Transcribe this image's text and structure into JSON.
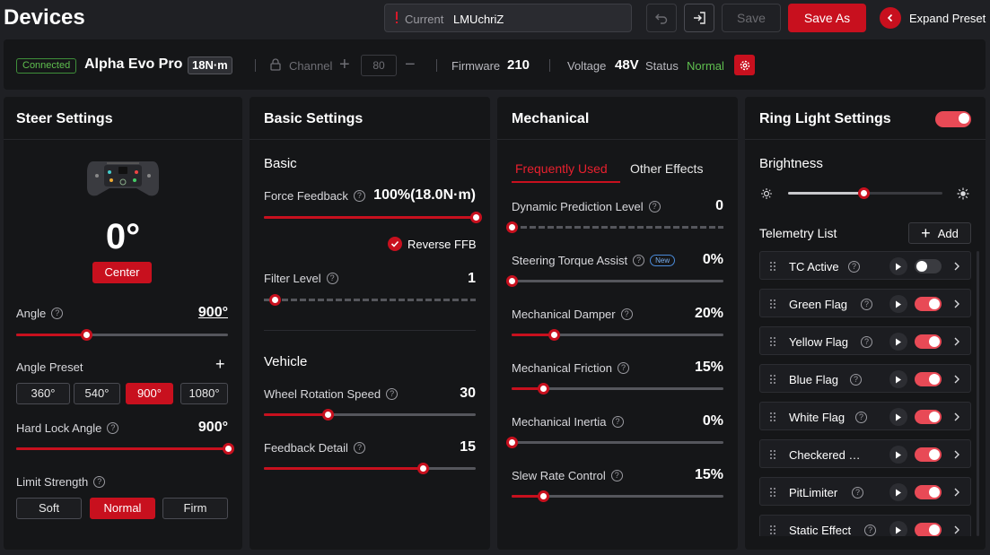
{
  "header": {
    "title": "Devices",
    "preset_label": "Current",
    "preset_value": "LMUchriZ",
    "save_label": "Save",
    "save_as_label": "Save As",
    "expand_label": "Expand Preset"
  },
  "device": {
    "status_badge": "Connected",
    "name": "Alpha Evo Pro",
    "torque": "18N·m",
    "channel_label": "Channel",
    "channel_value": "80",
    "firmware_label": "Firmware",
    "firmware_value": "210",
    "voltage_label": "Voltage",
    "voltage_value": "48V",
    "status_label": "Status",
    "status_value": "Normal"
  },
  "steer": {
    "title": "Steer Settings",
    "angle_display": "0°",
    "center_label": "Center",
    "angle_label": "Angle",
    "angle_value": "900°",
    "angle_level": 0.33,
    "preset_label": "Angle Preset",
    "presets": [
      "360°",
      "540°",
      "900°",
      "1080°"
    ],
    "active_preset": 2,
    "hard_lock_label": "Hard Lock Angle",
    "hard_lock_value": "900°",
    "hard_lock_level": 1.0,
    "limit_label": "Limit Strength",
    "limits": [
      "Soft",
      "Normal",
      "Firm"
    ],
    "active_limit": 1
  },
  "basic": {
    "title": "Basic Settings",
    "section_basic": "Basic",
    "ffb_label": "Force Feedback",
    "ffb_value": "100%(18.0N·m)",
    "ffb_level": 1.0,
    "reverse_label": "Reverse FFB",
    "filter_label": "Filter Level",
    "filter_value": "1",
    "filter_level": 0.05,
    "section_vehicle": "Vehicle",
    "wheel_speed_label": "Wheel Rotation Speed",
    "wheel_speed_value": "30",
    "wheel_speed_level": 0.3,
    "detail_label": "Feedback Detail",
    "detail_value": "15",
    "detail_level": 0.75
  },
  "mechanical": {
    "title": "Mechanical",
    "tab_frequent": "Frequently Used",
    "tab_other": "Other Effects",
    "items": [
      {
        "label": "Dynamic Prediction Level",
        "value": "0",
        "level": 0.0
      },
      {
        "label": "Steering Torque Assist",
        "value": "0%",
        "level": 0.0,
        "badge": "New"
      },
      {
        "label": "Mechanical Damper",
        "value": "20%",
        "level": 0.2
      },
      {
        "label": "Mechanical Friction",
        "value": "15%",
        "level": 0.15
      },
      {
        "label": "Mechanical Inertia",
        "value": "0%",
        "level": 0.0
      },
      {
        "label": "Slew Rate Control",
        "value": "15%",
        "level": 0.15
      }
    ]
  },
  "ring": {
    "title": "Ring Light Settings",
    "brightness_label": "Brightness",
    "brightness_level": 0.49,
    "telemetry_label": "Telemetry List",
    "add_label": "Add",
    "items": [
      {
        "name": "TC Active",
        "on": false
      },
      {
        "name": "Green Flag",
        "on": true
      },
      {
        "name": "Yellow Flag",
        "on": true
      },
      {
        "name": "Blue Flag",
        "on": true
      },
      {
        "name": "White Flag",
        "on": true
      },
      {
        "name": "Checkered …",
        "on": true
      },
      {
        "name": "PitLimiter",
        "on": true
      },
      {
        "name": "Static Effect",
        "on": true
      }
    ]
  },
  "colors": {
    "accent": "#c8101e",
    "ok": "#5fbf4f",
    "panel": "#151618",
    "background": "#1f2024"
  }
}
